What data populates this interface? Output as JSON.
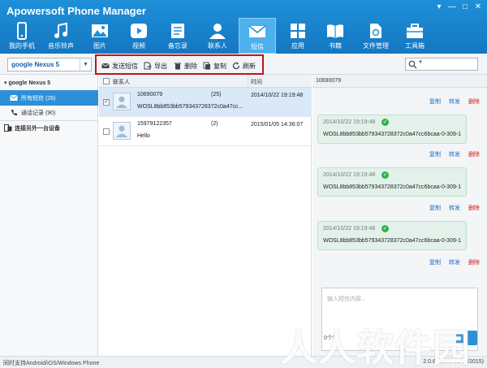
{
  "app": {
    "title": "Apowersoft Phone Manager"
  },
  "window_controls": [
    "▾",
    "—",
    "□",
    "✕"
  ],
  "nav": [
    {
      "label": "我的手机",
      "icon": "phone-icon"
    },
    {
      "label": "音乐铃声",
      "icon": "music-icon"
    },
    {
      "label": "图片",
      "icon": "picture-icon"
    },
    {
      "label": "视频",
      "icon": "video-icon"
    },
    {
      "label": "备忘录",
      "icon": "memo-icon"
    },
    {
      "label": "联系人",
      "icon": "contacts-icon"
    },
    {
      "label": "短信",
      "icon": "sms-icon",
      "active": true
    },
    {
      "label": "应用",
      "icon": "apps-icon"
    },
    {
      "label": "书籍",
      "icon": "books-icon"
    },
    {
      "label": "文件管理",
      "icon": "file-manager-icon"
    },
    {
      "label": "工具箱",
      "icon": "toolbox-icon"
    }
  ],
  "device_select": {
    "value": "google Nexus 5"
  },
  "actions": {
    "send_sms": "发送短信",
    "export": "导出",
    "delete": "删除",
    "copy": "复制",
    "refresh": "刷新"
  },
  "sidebar": {
    "device": "google Nexus 5",
    "items": [
      {
        "label": "所有短信 (28)",
        "icon": "envelope-icon",
        "active": true
      },
      {
        "label": "通话记录 (90)",
        "icon": "call-log-icon"
      }
    ],
    "connect": "连接另外一台设备"
  },
  "list": {
    "headers": {
      "contact": "联系人",
      "time": "时间"
    },
    "rows": [
      {
        "number": "10690079",
        "count": "(25)",
        "time": "2014/10/22 19:19:48",
        "preview": "WOSL8bb853bb579343728372c0a47cc...",
        "selected": true,
        "checked": true
      },
      {
        "number": "15979122357",
        "count": "(2)",
        "time": "2015/01/05 14:36:07",
        "preview": "Hello",
        "selected": false,
        "checked": false
      }
    ]
  },
  "conversation": {
    "header": "10690079",
    "msg_actions": {
      "copy": "复制",
      "forward": "转发",
      "delete": "删除"
    },
    "messages": [
      {
        "time": "2014/10/22 19:19:48",
        "text": "WOSL8bb853bb579343728372c0a47cc6bcaa-0-309-1"
      },
      {
        "time": "2014/10/22 19:19:48",
        "text": "WOSL8bb853bb579343728372c0a47cc6bcaa-0-309-1"
      },
      {
        "time": "2014/10/22 19:19:48",
        "text": "WOSL8bb853bb579343728372c0a47cc6bcaa-0-309-1"
      }
    ],
    "compose_placeholder": "输入短信内容...",
    "char_count": "0个字"
  },
  "status": {
    "left": "同时支持Android/iOS/Windows Phone",
    "right": "2.0.6 (Build 01/06/2015)"
  },
  "watermark": "人人软件园",
  "colors": {
    "header": "#1e90d8",
    "active_item": "#2d8fd8",
    "highlight_box": "#c0161b",
    "delete_red": "#d21a1a"
  }
}
